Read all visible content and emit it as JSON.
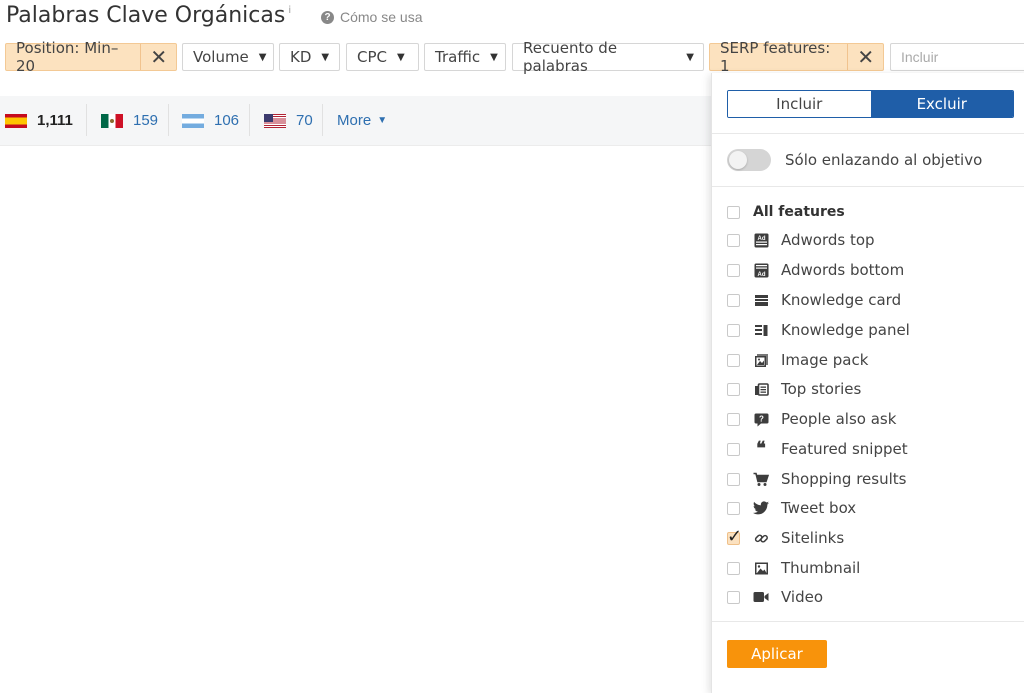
{
  "header": {
    "title": "Palabras Clave Orgánicas",
    "title_sup": "i",
    "help_icon": "question-circle-icon",
    "help_text": "Cómo se usa"
  },
  "filters": {
    "position_label": "Position: Min–20",
    "volume": "Volume",
    "kd": "KD",
    "cpc": "CPC",
    "traffic": "Traffic",
    "word_count": "Recuento de palabras",
    "serp_label": "SERP features: 1",
    "include_placeholder": "Incluir",
    "colors": {
      "active_bg": "#fce2bf",
      "border": "#d6d6d6"
    }
  },
  "countries": [
    {
      "flag": "spain-flag",
      "count": "1,111"
    },
    {
      "flag": "mexico-flag",
      "count": "159"
    },
    {
      "flag": "argentina-flag",
      "count": "106"
    },
    {
      "flag": "usa-flag",
      "count": "70"
    }
  ],
  "more_label": "More",
  "panel": {
    "include_tab": "Incluir",
    "exclude_tab": "Excluir",
    "selected_tab": "Excluir",
    "toggle_label": "Sólo enlazando al objetivo",
    "toggle_on": false,
    "all_label": "All features",
    "features": [
      {
        "label": "Adwords top",
        "icon": "ad-top-icon",
        "checked": false
      },
      {
        "label": "Adwords bottom",
        "icon": "ad-bottom-icon",
        "checked": false
      },
      {
        "label": "Knowledge card",
        "icon": "knowledge-card-icon",
        "checked": false
      },
      {
        "label": "Knowledge panel",
        "icon": "knowledge-panel-icon",
        "checked": false
      },
      {
        "label": "Image pack",
        "icon": "image-pack-icon",
        "checked": false
      },
      {
        "label": "Top stories",
        "icon": "top-stories-icon",
        "checked": false
      },
      {
        "label": "People also ask",
        "icon": "people-also-ask-icon",
        "checked": false
      },
      {
        "label": "Featured snippet",
        "icon": "quote-icon",
        "checked": false
      },
      {
        "label": "Shopping results",
        "icon": "cart-icon",
        "checked": false
      },
      {
        "label": "Tweet box",
        "icon": "twitter-icon",
        "checked": false
      },
      {
        "label": "Sitelinks",
        "icon": "link-icon",
        "checked": true
      },
      {
        "label": "Thumbnail",
        "icon": "thumbnail-icon",
        "checked": false
      },
      {
        "label": "Video",
        "icon": "video-icon",
        "checked": false
      }
    ],
    "apply_label": "Aplicar",
    "colors": {
      "segment_active": "#1f5ea8",
      "apply": "#f8930b"
    }
  }
}
